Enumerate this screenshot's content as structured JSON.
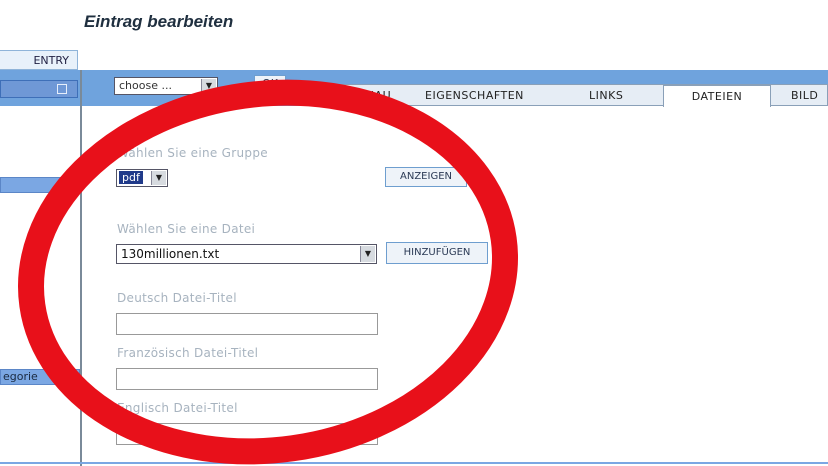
{
  "page": {
    "title": "Eintrag bearbeiten"
  },
  "sidebar": {
    "entry_label": "ENTRY",
    "category_label": "egorie"
  },
  "toolbar": {
    "choose_select": "choose ...",
    "ok_label": "OK"
  },
  "tabs": [
    {
      "label": "VORSCHAU"
    },
    {
      "label": "EIGENSCHAFTEN"
    },
    {
      "label": "LINKS"
    },
    {
      "label": "DATEIEN",
      "active": true
    },
    {
      "label": "BILD"
    }
  ],
  "form": {
    "group_label": "Wählen Sie eine Gruppe",
    "group_value": "pdf",
    "show_button": "ANZEIGEN",
    "file_label": "Wählen Sie eine Datei",
    "file_value": "130millionen.txt",
    "add_button": "HINZUFÜGEN",
    "de_title_label": "Deutsch Datei-Titel",
    "de_title_value": "",
    "fr_title_label": "Französisch Datei-Titel",
    "fr_title_value": "",
    "en_title_label": "Englisch Datei-Titel",
    "en_title_value": ""
  },
  "colors": {
    "accent_blue": "#6fa3dd",
    "annotation_red": "#e8101a"
  }
}
